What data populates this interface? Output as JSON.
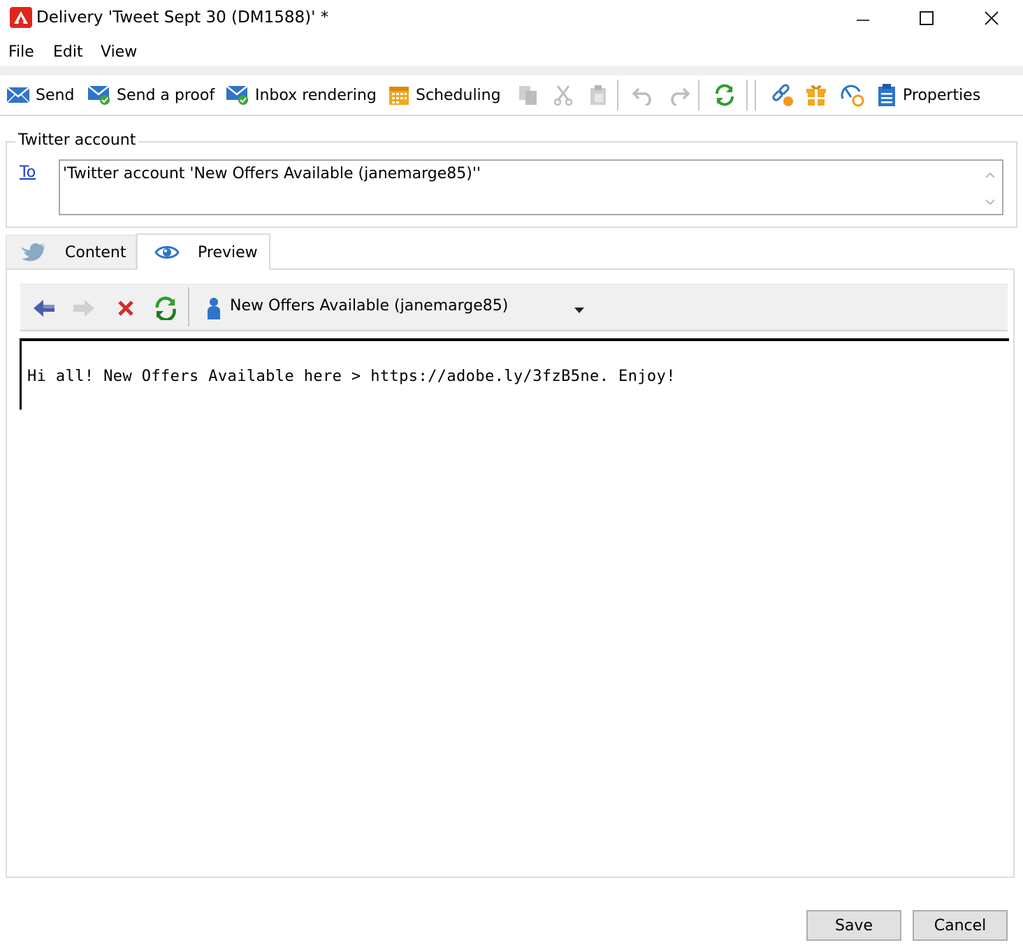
{
  "window": {
    "title": "Delivery 'Tweet Sept 30 (DM1588)' *",
    "controls": [
      "minimize",
      "maximize",
      "close"
    ]
  },
  "menu": {
    "items": [
      "File",
      "Edit",
      "View"
    ]
  },
  "toolbar": {
    "send_label": "Send",
    "send_proof_label": "Send a proof",
    "inbox_rendering_label": "Inbox rendering",
    "scheduling_label": "Scheduling",
    "properties_label": "Properties"
  },
  "twitter_account": {
    "legend": "Twitter account",
    "to_label": "To",
    "to_value": "'Twitter account 'New Offers Available (janemarge85)''"
  },
  "tabs": [
    {
      "label": "Content",
      "icon": "twitter-bird-icon",
      "active": false
    },
    {
      "label": "Preview",
      "icon": "eye-icon",
      "active": true
    }
  ],
  "preview": {
    "recipient": "New Offers Available (janemarge85)",
    "message": "Hi all! New Offers Available here > https://adobe.ly/3fzB5ne. Enjoy!"
  },
  "buttons": {
    "save": "Save",
    "cancel": "Cancel"
  },
  "colors": {
    "brand_red": "#e1251b",
    "link_blue": "#1a3dcc",
    "refresh_green": "#2e9e2e"
  }
}
